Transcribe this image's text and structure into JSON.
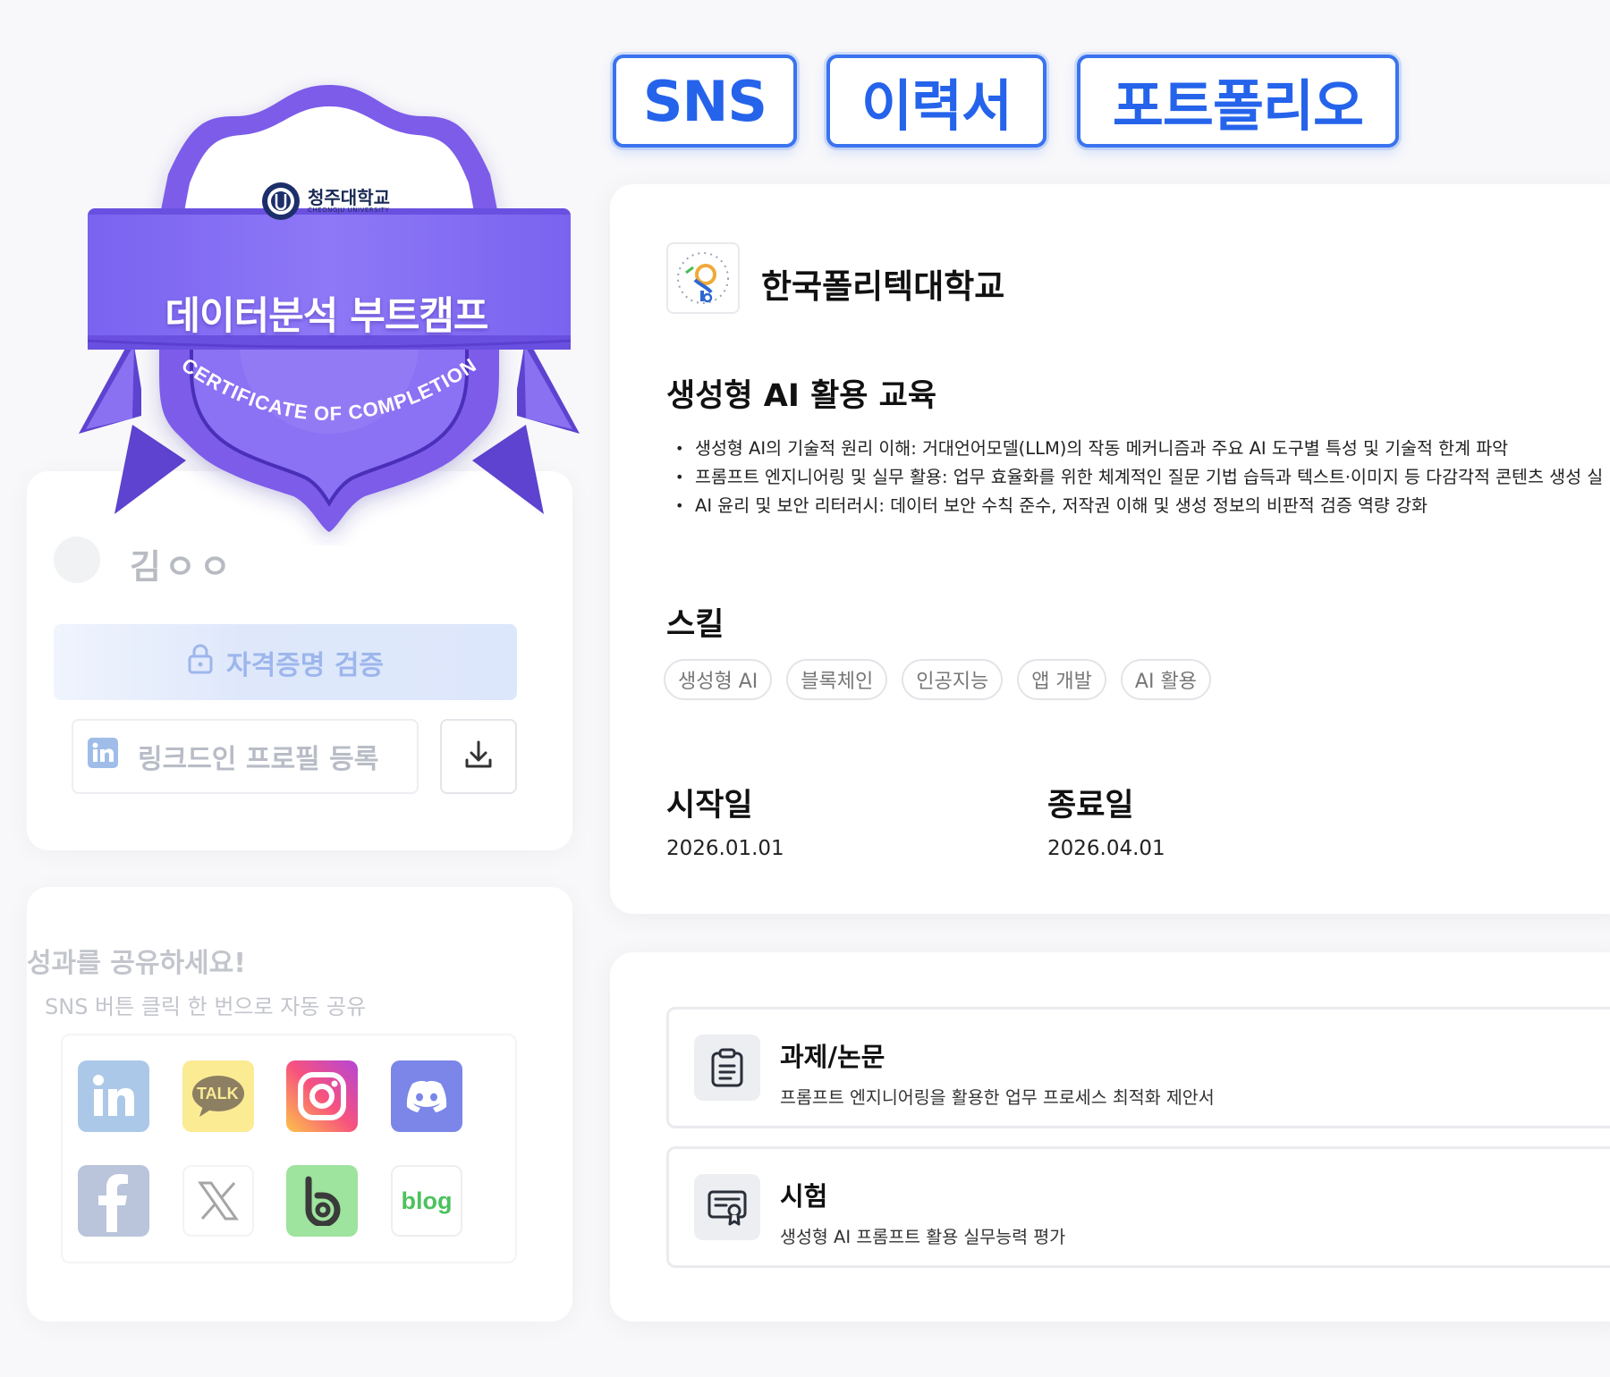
{
  "top_tags": [
    "SNS",
    "이력서",
    "포트폴리오"
  ],
  "badge": {
    "university_ko": "청주대학교",
    "university_en": "CHEONGJU UNIVERSITY",
    "title": "데이터분석 부트캠프",
    "arc_text": "CERTIFICATE OF COMPLETION"
  },
  "profile": {
    "name": "김ㅇㅇ",
    "verify_label": "자격증명 검증",
    "linkedin_label": "링크드인 프로필 등록"
  },
  "share": {
    "title": "성과를 공유하세요!",
    "subtitle": "SNS 버튼 클릭 한 번으로 자동 공유",
    "kakao_text": "TALK",
    "blog_text": "blog"
  },
  "course": {
    "org_name": "한국폴리텍대학교",
    "title": "생성형 AI 활용 교육",
    "bullets": [
      "생성형 AI의 기술적 원리 이해: 거대언어모델(LLM)의 작동 메커니즘과 주요 AI 도구별 특성 및 기술적 한계 파악",
      "프롬프트 엔지니어링 및 실무 활용: 업무 효율화를 위한 체계적인 질문 기법 습득과 텍스트·이미지 등 다감각적 콘텐츠 생성 실",
      "AI 윤리 및 보안 리터러시: 데이터 보안 수칙 준수, 저작권 이해 및 생성 정보의 비판적 검증 역량 강화"
    ],
    "skills_heading": "스킬",
    "skills": [
      "생성형 AI",
      "블록체인",
      "인공지능",
      "앱 개발",
      "AI 활용"
    ],
    "start_label": "시작일",
    "start_date": "2026.01.01",
    "end_label": "종료일",
    "end_date": "2026.04.01"
  },
  "tasks": [
    {
      "title": "과제/논문",
      "desc": "프롬프트 엔지니어링을 활용한 업무 프로세스 최적화 제안서",
      "icon": "clipboard-icon"
    },
    {
      "title": "시험",
      "desc": "생성형 AI 프롬프트 활용 실무능력 평가",
      "icon": "certificate-icon"
    }
  ],
  "colors": {
    "accent_blue": "#2563eb",
    "badge_purple": "#7c5ce9",
    "badge_light": "#9a7ff5"
  }
}
